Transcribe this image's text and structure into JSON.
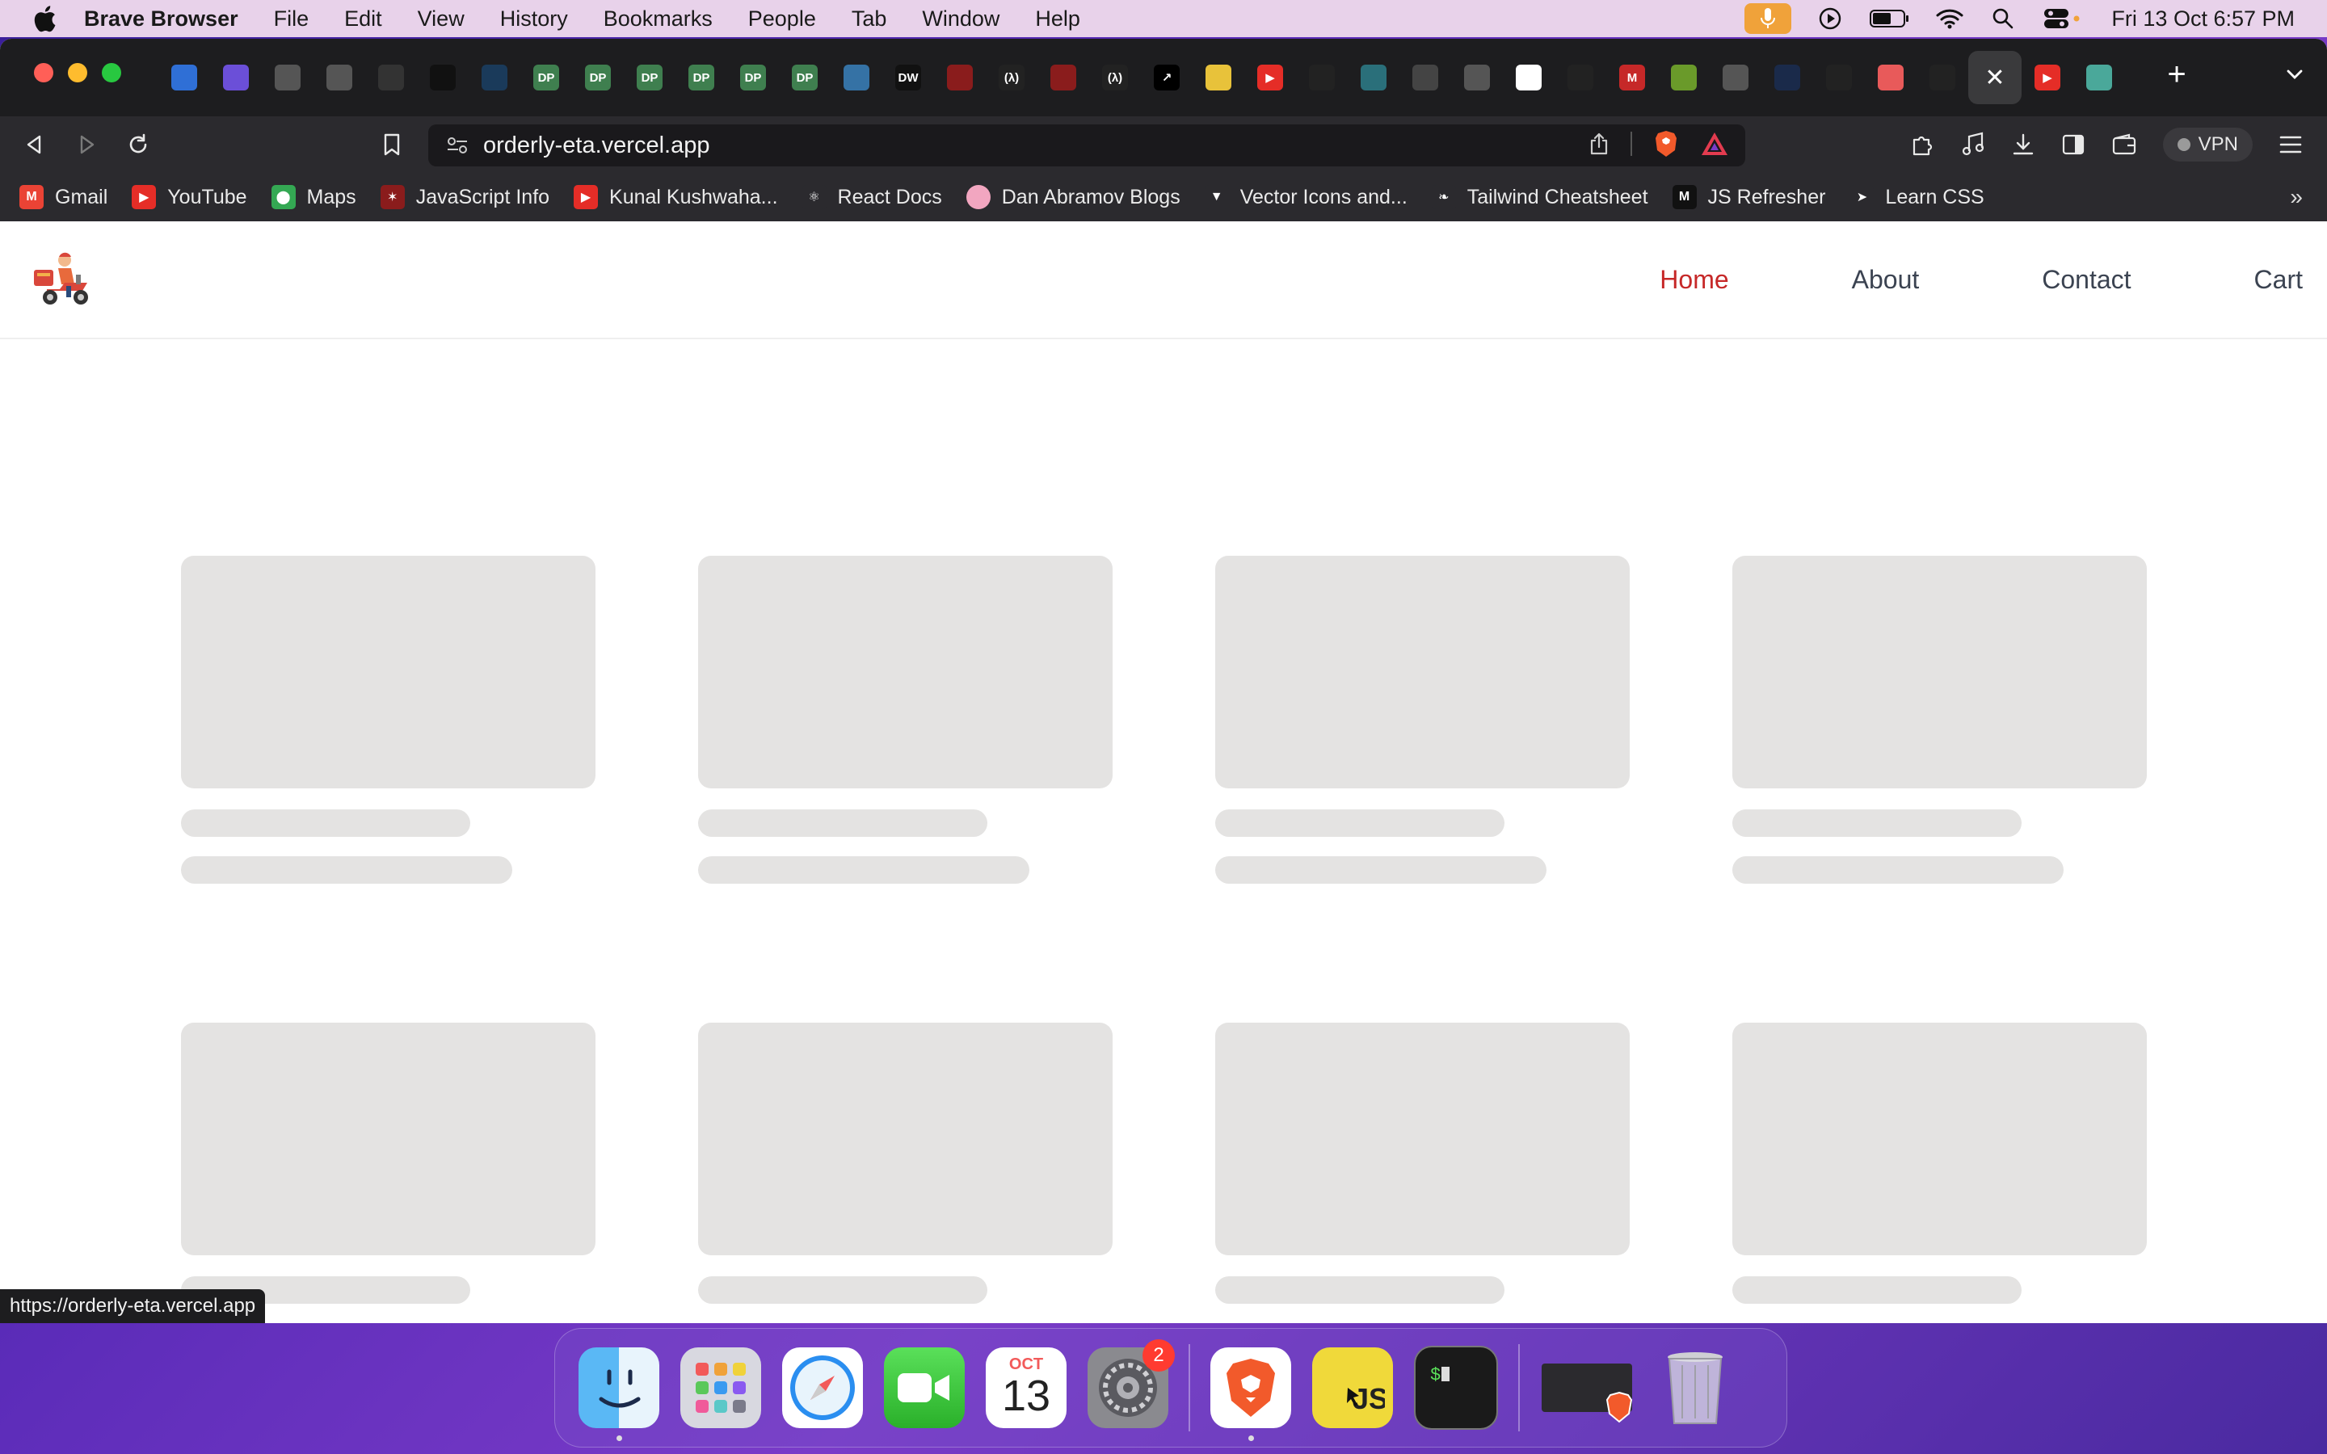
{
  "menubar": {
    "app_name": "Brave Browser",
    "items": [
      "File",
      "Edit",
      "View",
      "History",
      "Bookmarks",
      "People",
      "Tab",
      "Window",
      "Help"
    ],
    "clock": "Fri 13 Oct  6:57 PM"
  },
  "tabs": {
    "favicons": [
      {
        "icon": "app-icon",
        "color": "#2f6fd6",
        "text": ""
      },
      {
        "icon": "list-icon",
        "color": "#6b4fd8",
        "text": ""
      },
      {
        "icon": "globe-icon",
        "color": "#555",
        "text": ""
      },
      {
        "icon": "globe-icon",
        "color": "#555",
        "text": ""
      },
      {
        "icon": "framer-icon",
        "color": "#333",
        "text": ""
      },
      {
        "icon": "medium-icon",
        "color": "#111",
        "text": ""
      },
      {
        "icon": "spinner-icon",
        "color": "#1a3a5a",
        "text": ""
      },
      {
        "icon": "dp-icon",
        "color": "#3f7f4f",
        "text": "DP"
      },
      {
        "icon": "dp-icon",
        "color": "#3f7f4f",
        "text": "DP"
      },
      {
        "icon": "dp-icon",
        "color": "#3f7f4f",
        "text": "DP"
      },
      {
        "icon": "dp-icon",
        "color": "#3f7f4f",
        "text": "DP"
      },
      {
        "icon": "dp-icon",
        "color": "#3f7f4f",
        "text": "DP"
      },
      {
        "icon": "dp-icon",
        "color": "#3f7f4f",
        "text": "DP"
      },
      {
        "icon": "python-icon",
        "color": "#3572a5",
        "text": ""
      },
      {
        "icon": "dw-icon",
        "color": "#111",
        "text": "DW"
      },
      {
        "icon": "figure-icon",
        "color": "#8a1c1c",
        "text": ""
      },
      {
        "icon": "lambda-icon",
        "color": "#222",
        "text": "(λ)"
      },
      {
        "icon": "figure-icon",
        "color": "#8a1c1c",
        "text": ""
      },
      {
        "icon": "lambda-icon",
        "color": "#222",
        "text": "(λ)"
      },
      {
        "icon": "arrow-icon",
        "color": "#000",
        "text": "↗"
      },
      {
        "icon": "note-icon",
        "color": "#e8c23a",
        "text": ""
      },
      {
        "icon": "youtube-icon",
        "color": "#e52d27",
        "text": "▶"
      },
      {
        "icon": "github-icon",
        "color": "#222",
        "text": ""
      },
      {
        "icon": "wave-icon",
        "color": "#2a6f7a",
        "text": ""
      },
      {
        "icon": "gear-icon",
        "color": "#444",
        "text": ""
      },
      {
        "icon": "globe-icon",
        "color": "#555",
        "text": ""
      },
      {
        "icon": "codepen-icon",
        "color": "#fff",
        "text": ""
      },
      {
        "icon": "github-icon",
        "color": "#222",
        "text": ""
      },
      {
        "icon": "m-icon",
        "color": "#c62828",
        "text": "M"
      },
      {
        "icon": "leaf-icon",
        "color": "#6a9a2a",
        "text": ""
      },
      {
        "icon": "globe-icon",
        "color": "#555",
        "text": ""
      },
      {
        "icon": "moon-icon",
        "color": "#1a2a4a",
        "text": ""
      },
      {
        "icon": "github-icon",
        "color": "#222",
        "text": ""
      },
      {
        "icon": "record-icon",
        "color": "#e85a5a",
        "text": ""
      },
      {
        "icon": "github-icon",
        "color": "#222",
        "text": ""
      }
    ],
    "trailing_favicons": [
      {
        "icon": "youtube-icon",
        "color": "#e52d27",
        "text": "▶"
      },
      {
        "icon": "chatgpt-icon",
        "color": "#4aa89a",
        "text": ""
      }
    ],
    "close_glyph": "✕",
    "new_tab_glyph": "+"
  },
  "address": {
    "url": "orderly-eta.vercel.app"
  },
  "toolbar": {
    "vpn_label": "VPN"
  },
  "bookmarks": [
    {
      "label": "Gmail",
      "icon": "gmail-icon",
      "color": "#ea4335",
      "glyph": "M"
    },
    {
      "label": "YouTube",
      "icon": "youtube-icon",
      "color": "#e52d27",
      "glyph": "▶"
    },
    {
      "label": "Maps",
      "icon": "maps-icon",
      "color": "#34a853",
      "glyph": "⬤"
    },
    {
      "label": "JavaScript Info",
      "icon": "figure-icon",
      "color": "#8a1c1c",
      "glyph": "✶"
    },
    {
      "label": "Kunal Kushwaha...",
      "icon": "youtube-icon",
      "color": "#e52d27",
      "glyph": "▶"
    },
    {
      "label": "React Docs",
      "icon": "react-icon",
      "color": "#2b2a2e",
      "glyph": "⚛"
    },
    {
      "label": "Dan Abramov Blogs",
      "icon": "avatar-icon",
      "color": "#f2a6c0",
      "glyph": ""
    },
    {
      "label": "Vector Icons and...",
      "icon": "vector-icon",
      "color": "#2b2a2e",
      "glyph": "▼"
    },
    {
      "label": "Tailwind Cheatsheet",
      "icon": "tailwind-icon",
      "color": "#2b2a2e",
      "glyph": "❧"
    },
    {
      "label": "JS Refresher",
      "icon": "m-icon",
      "color": "#111",
      "glyph": "M"
    },
    {
      "label": "Learn CSS",
      "icon": "css-icon",
      "color": "#2b2a2e",
      "glyph": "➤"
    }
  ],
  "site": {
    "nav": [
      {
        "label": "Home",
        "active": true
      },
      {
        "label": "About",
        "active": false
      },
      {
        "label": "Contact",
        "active": false
      },
      {
        "label": "Cart",
        "active": false
      }
    ],
    "accent": "#c62828",
    "skeleton_color": "#e4e3e2"
  },
  "status_bar": {
    "url": "https://orderly-eta.vercel.app"
  },
  "dock": {
    "apps": [
      {
        "name": "finder-icon",
        "running": true
      },
      {
        "name": "launchpad-icon",
        "running": false
      },
      {
        "name": "safari-icon",
        "running": false
      },
      {
        "name": "facetime-icon",
        "running": false
      },
      {
        "name": "calendar-icon",
        "running": false
      },
      {
        "name": "system-settings-icon",
        "running": false,
        "badge": "2"
      }
    ],
    "calendar_month": "OCT",
    "calendar_day": "13",
    "pinned": [
      {
        "name": "brave-icon",
        "running": true
      },
      {
        "name": "javascript-icon",
        "running": false
      },
      {
        "name": "terminal-icon",
        "running": false
      }
    ]
  }
}
